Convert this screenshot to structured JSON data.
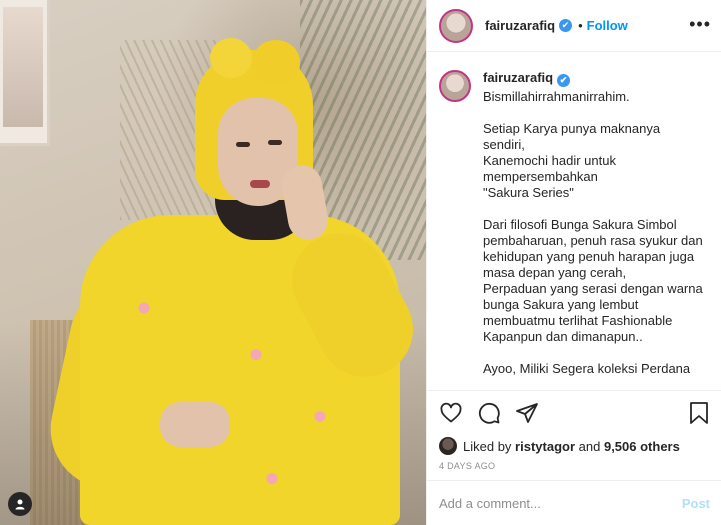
{
  "post": {
    "username": "fairuzarafiq",
    "verified_glyph": "✔",
    "dot": "•",
    "follow_label": "Follow",
    "more_label": "•••"
  },
  "caption": {
    "username": "fairuzarafiq",
    "text": "Bismillahirrahmanirrahim.\n\nSetiap Karya punya maknanya sendiri,\nKanemochi hadir untuk mempersembahkan\n\"Sakura Series\"\n\nDari filosofi Bunga Sakura Simbol pembaharuan, penuh rasa syukur dan kehidupan yang penuh harapan juga masa depan yang cerah,\nPerpaduan yang serasi dengan warna bunga Sakura yang lembut membuatmu terlihat Fashionable Kapanpun dan dimanapun..\n\nAyoo, Miliki Segera koleksi Perdana"
  },
  "actions": {
    "icons": [
      "heart-icon",
      "comment-icon",
      "share-icon",
      "bookmark-icon"
    ],
    "liked_prefix": "Liked by",
    "liked_user": "ristytagor",
    "liked_and": "and",
    "liked_count": "9,506 others",
    "date": "4 DAYS AGO"
  },
  "comment": {
    "placeholder": "Add a comment...",
    "post_label": "Post"
  },
  "colors": {
    "accent": "#0095f6",
    "post_disabled": "#b2dffc",
    "verified": "#3897f0",
    "dress": "#f2d52b"
  }
}
